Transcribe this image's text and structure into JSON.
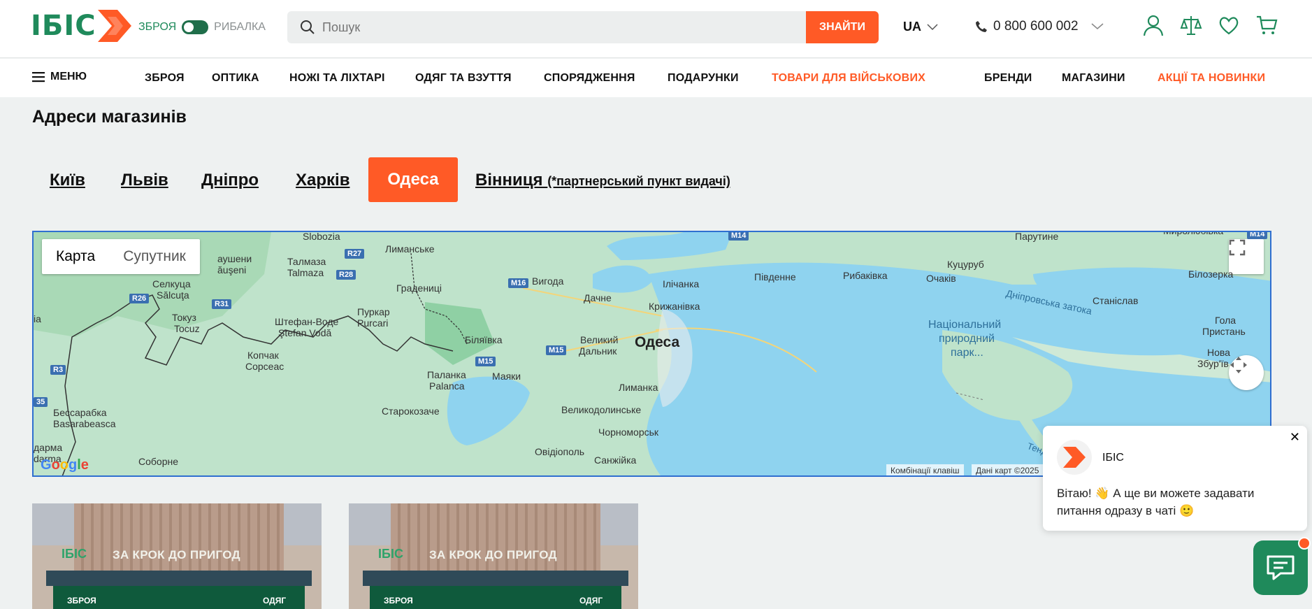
{
  "header": {
    "logo_text": "ІБІС",
    "toggle_left": "ЗБРОЯ",
    "toggle_right": "РИБАЛКА",
    "search_placeholder": "Пошук",
    "search_button": "ЗНАЙТИ",
    "language": "UA",
    "phone": "0 800 600 002",
    "brand_green": "#1f8a5b",
    "brand_orange": "#ff5a26"
  },
  "nav": {
    "menu_label": "МЕНЮ",
    "items": [
      {
        "label": "ЗБРОЯ"
      },
      {
        "label": "ОПТИКА"
      },
      {
        "label": "НОЖІ ТА ЛІХТАРІ"
      },
      {
        "label": "ОДЯГ ТА ВЗУТТЯ"
      },
      {
        "label": "СПОРЯДЖЕННЯ"
      },
      {
        "label": "ПОДАРУНКИ"
      },
      {
        "label": "ТОВАРИ ДЛЯ ВІЙСЬКОВИХ"
      },
      {
        "label": "БРЕНДИ"
      },
      {
        "label": "МАГАЗИНИ"
      },
      {
        "label": "АКЦІЇ ТА НОВИНКИ"
      }
    ]
  },
  "page": {
    "title": "Адреси магазинів",
    "cities": [
      {
        "label": "Київ"
      },
      {
        "label": "Львів"
      },
      {
        "label": "Дніпро"
      },
      {
        "label": "Харків"
      },
      {
        "label": "Одеса",
        "active": true
      },
      {
        "label": "Вінниця",
        "note": "(*партнерський пункт видачі)"
      }
    ]
  },
  "map": {
    "type_map": "Карта",
    "type_satellite": "Супутник",
    "logo": "Google",
    "shortcuts": "Комбінації клавіш",
    "attribution": "Дані карт ©2025",
    "labels": {
      "odesa": "Одеса",
      "slobozia": "Slobozia",
      "limanske": "Лиманське",
      "talmaza": "Талмаза",
      "talmaza_ro": "Talmaza",
      "ausheni": "аушени",
      "ausheni2": "ăuşeni",
      "selkutsa": "Селкуца",
      "salcuta": "Sălcuţa",
      "hradenitsi": "Градениці",
      "vyhoda": "Вигода",
      "dachne": "Дачне",
      "ilichanka": "Ілічанка",
      "kryzhanivka": "Крижанівка",
      "tokuz": "Токуз",
      "tocuz": "Tocuz",
      "shtefan": "Штефан-Воде",
      "stefan": "Ştefan Vodă",
      "purkar": "Пуркар",
      "purcari": "Purcari",
      "biliaivka": "Біляївка",
      "velykyi": "Великий",
      "dalnyk": "Дальник",
      "kopchak": "Копчак",
      "copceac": "Copceac",
      "palanka": "Паланка",
      "palanca": "Palanca",
      "mayaky": "Маяки",
      "lymanka": "Лиманка",
      "starokozache": "Старокозаче",
      "velykodolynske": "Великодолинське",
      "chornomorsk": "Чорноморськ",
      "besarabka": "Бессарабка",
      "basarabeasca": "Basarabeasca",
      "ovidiopol": "Овідіополь",
      "sanzhiika": "Санжійка",
      "sobornie": "Соборне",
      "darma": "дарма",
      "darma2": "darma",
      "ia": "ia",
      "pivdenne": "Південне",
      "rybakivka": "Рибаківка",
      "ochakiv": "Очаків",
      "kutsuruб": "Куцуруб",
      "parutyne": "Парутине",
      "stanislav": "Станіслав",
      "bilozerka": "Білозерка",
      "hola": "Гола",
      "prystan": "Пристань",
      "nova": "Нова",
      "zburiiv": "Збур'їв",
      "zatoka": "Дніпровська затока",
      "park1": "Національний",
      "park2": "природний",
      "park3": "парк...",
      "tendr": "Тендрівська",
      "myr": "Миролюбівка"
    },
    "roads": [
      "M14",
      "R27",
      "R28",
      "M16",
      "R26",
      "R31",
      "M15",
      "M15",
      "R3",
      "35",
      "M14"
    ]
  },
  "chat": {
    "name": "ІБІС",
    "message": "Вітаю! 👋 А ще ви можете задавати питання одразу в чаті 🙂",
    "close": "✕"
  },
  "stores": [
    {
      "slogan": "ЗА КРОК ДО ПРИГОД",
      "logo": "ІБІС",
      "left_sign": "ЗБРОЯ",
      "right_sign": "ОДЯГ"
    },
    {
      "slogan": "ЗА КРОК ДО ПРИГОД",
      "logo": "ІБІС",
      "left_sign": "ЗБРОЯ",
      "right_sign": "ОДЯГ"
    }
  ]
}
